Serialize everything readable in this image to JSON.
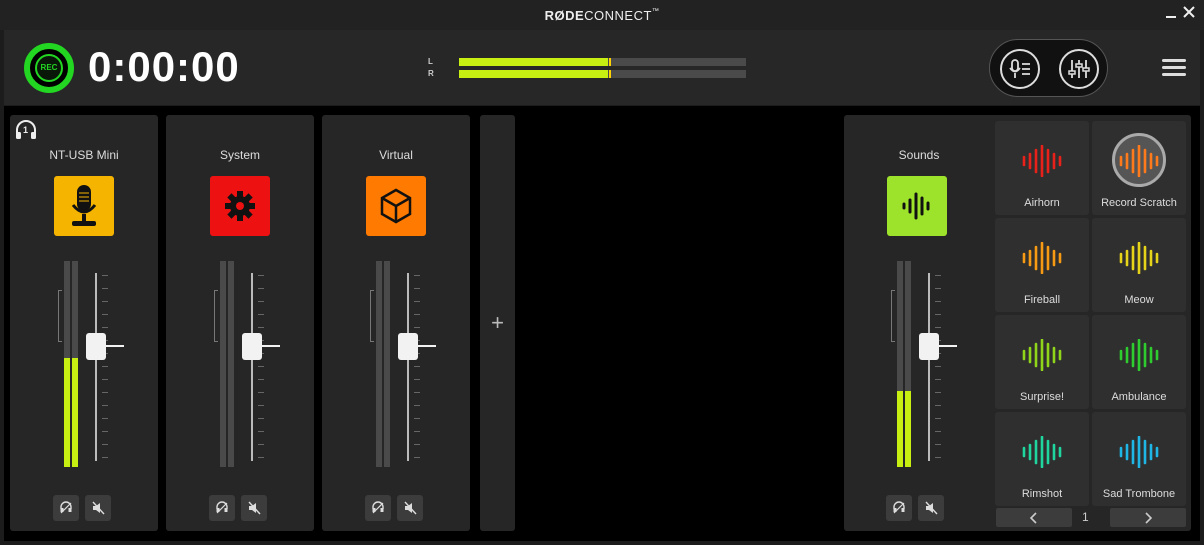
{
  "titlebar": {
    "brand_bold": "RØDE",
    "brand_rest": "CONNECT",
    "trademark": "™",
    "minimize_icon": "minimize-icon",
    "close_icon": "close-icon"
  },
  "header": {
    "rec_label": "REC",
    "timer": "0:00:00",
    "meter": {
      "left_label": "L",
      "right_label": "R",
      "left_level": 0.52,
      "right_level": 0.52
    },
    "colors": {
      "rec": "#22d622",
      "meter": "#c8ef12"
    }
  },
  "channels": [
    {
      "name": "NT-USB Mini",
      "icon": "microphone-icon",
      "icon_color": "#f5b400",
      "level": 0.53,
      "fader": 0.58,
      "headphone_monitor": "1"
    },
    {
      "name": "System",
      "icon": "gear-icon",
      "icon_color": "#ee1111",
      "level": 0,
      "fader": 0.58
    },
    {
      "name": "Virtual",
      "icon": "cube-icon",
      "icon_color": "#ff7a00",
      "level": 0,
      "fader": 0.58
    }
  ],
  "add_channel": "+",
  "sounds": {
    "title": "Sounds",
    "icon_color": "#9ee32b",
    "level": 0.37,
    "fader": 0.58,
    "pads": [
      {
        "label": "Airhorn",
        "color": "#e8221a"
      },
      {
        "label": "Record Scratch",
        "color": "#ff7a1a"
      },
      {
        "label": "Fireball",
        "color": "#f59a12"
      },
      {
        "label": "Meow",
        "color": "#e6d41a"
      },
      {
        "label": "Surprise!",
        "color": "#8fd61a"
      },
      {
        "label": "Ambulance",
        "color": "#2fcc2f"
      },
      {
        "label": "Rimshot",
        "color": "#1fd69e"
      },
      {
        "label": "Sad Trombone",
        "color": "#1fb6e6"
      }
    ],
    "page": "1"
  }
}
